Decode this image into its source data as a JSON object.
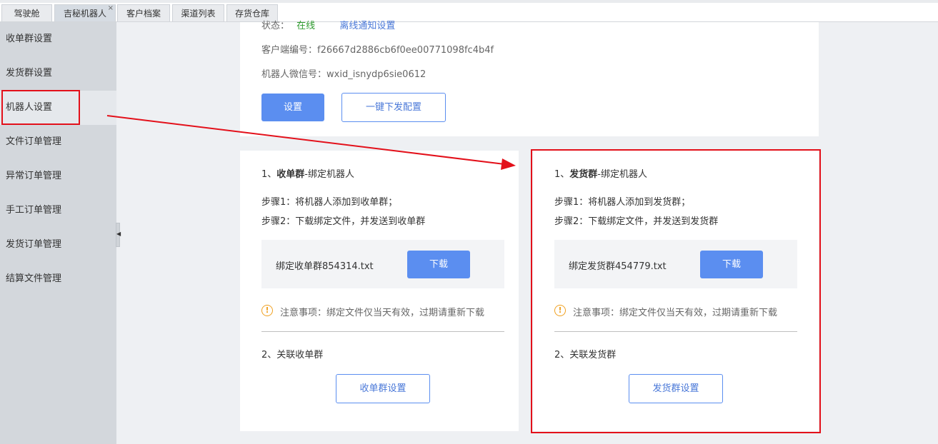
{
  "tabs": [
    {
      "label": "驾驶舱",
      "active": false
    },
    {
      "label": "吉秘机器人",
      "active": true,
      "close": "×"
    },
    {
      "label": "客户档案",
      "active": false
    },
    {
      "label": "渠道列表",
      "active": false
    },
    {
      "label": "存货仓库",
      "active": false
    }
  ],
  "sidebar": {
    "items": [
      {
        "label": "收单群设置"
      },
      {
        "label": "发货群设置"
      },
      {
        "label": "机器人设置",
        "active": true
      },
      {
        "label": "文件订单管理"
      },
      {
        "label": "异常订单管理"
      },
      {
        "label": "手工订单管理"
      },
      {
        "label": "发货订单管理"
      },
      {
        "label": "结算文件管理"
      }
    ]
  },
  "robot": {
    "status_label": "状态：",
    "status_value": "在线",
    "offline_notice_link": "离线通知设置",
    "client_id_label": "客户端编号：",
    "client_id": "f26667d2886cb6f0ee00771098fc4b4f",
    "wechat_id_label": "机器人微信号：",
    "wechat_id": "wxid_isnydp6sie0612",
    "settings_button": "设置",
    "one_click_button": "一键下发配置"
  },
  "collect_group": {
    "step_title_prefix": "1、",
    "step_title_bold": "收单群",
    "step_title_suffix": "-绑定机器人",
    "step1": "步骤1：将机器人添加到收单群；",
    "step2": "步骤2：下载绑定文件，并发送到收单群",
    "file_name": "绑定收单群854314.txt",
    "download_button": "下载",
    "note_icon": "!",
    "note": "注意事项：绑定文件仅当天有效，过期请重新下载",
    "link_title": "2、关联收单群",
    "settings_button": "收单群设置"
  },
  "ship_group": {
    "step_title_prefix": "1、",
    "step_title_bold": "发货群",
    "step_title_suffix": "-绑定机器人",
    "step1": "步骤1：将机器人添加到发货群；",
    "step2": "步骤2：下载绑定文件，并发送到发货群",
    "file_name": "绑定发货群454779.txt",
    "download_button": "下载",
    "note_icon": "!",
    "note": "注意事项：绑定文件仅当天有效，过期请重新下载",
    "link_title": "2、关联发货群",
    "settings_button": "发货群设置"
  },
  "colors": {
    "accent": "#5b8ef0",
    "status_online": "#2e9a2e",
    "highlight": "#e3101a",
    "warning": "#f0a020"
  }
}
